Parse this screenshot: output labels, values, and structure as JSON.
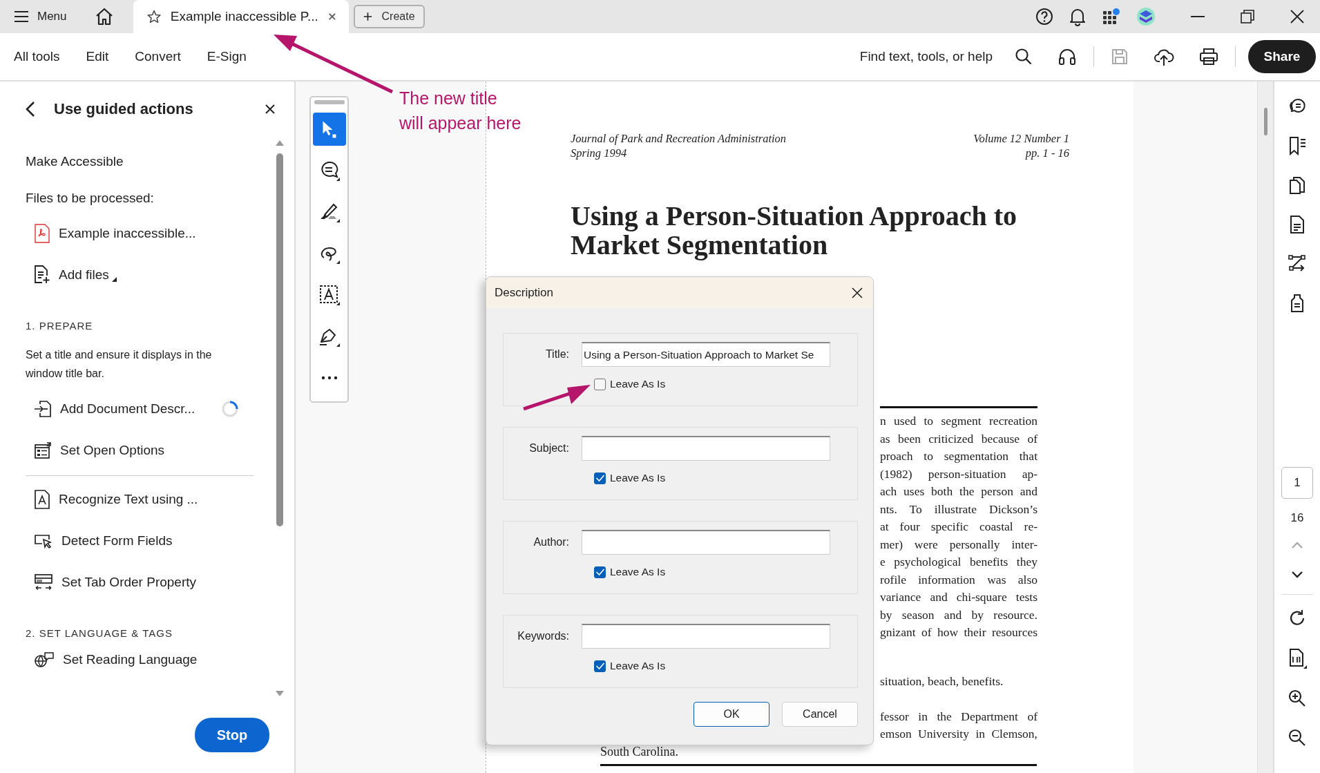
{
  "menu_bar": {
    "menu_label": "Menu",
    "tab": {
      "title": "Example inaccessible P...",
      "selected": true
    },
    "create_button": "Create",
    "apps_notification": true
  },
  "toolbar": {
    "menus": [
      "All tools",
      "Edit",
      "Convert",
      "E-Sign"
    ],
    "search_label": "Find text, tools, or help",
    "save_disabled": true,
    "share_button": "Share"
  },
  "sidebar": {
    "title": "Use guided actions",
    "heading": "Make Accessible",
    "files_label": "Files to be processed:",
    "files": [
      "Example inaccessible..."
    ],
    "add_files": "Add files",
    "sections": [
      {
        "title": "1. PREPARE",
        "description": "Set a title and ensure it displays in the window title bar.",
        "actions": [
          {
            "label": "Add Document Descr...",
            "kind": "describe",
            "in_progress": true,
            "divider_before": false
          },
          {
            "label": "Set Open Options",
            "kind": "open-options",
            "in_progress": false,
            "divider_before": false
          },
          {
            "label": "Recognize Text using ...",
            "kind": "ocr",
            "in_progress": false,
            "divider_before": true
          },
          {
            "label": "Detect Form Fields",
            "kind": "form-fields",
            "in_progress": false,
            "divider_before": false
          },
          {
            "label": "Set Tab Order Property",
            "kind": "tab-order",
            "in_progress": false,
            "divider_before": false
          }
        ]
      },
      {
        "title": "2. SET LANGUAGE & TAGS",
        "actions": [
          {
            "label": "Set Reading Language",
            "kind": "language",
            "in_progress": false,
            "divider_before": false
          }
        ]
      }
    ],
    "stop_button": "Stop"
  },
  "annotation": {
    "text": "The new title\nwill appear here"
  },
  "document": {
    "header_left": [
      "Journal of Park and Recreation Administration",
      "Spring 1994"
    ],
    "header_right": [
      "Volume 12 Number 1",
      "pp. 1 - 16"
    ],
    "title": "Using a Person-Situation Approach to Market Segmentation",
    "abstract_lines": [
      "n used to segment recreation",
      "as been criticized because of",
      "proach to segmentation that",
      "(1982) person-situation ap-",
      "ach uses both the person and",
      "nts. To illustrate Dickson’s",
      "at four specific coastal re-",
      "mer) were personally inter-",
      "e psychological benefits they",
      "rofile information was also",
      "variance and chi-square tests",
      "by season and by resource.",
      "gnizant of how their resources"
    ],
    "keywords_line": "situation, beach, benefits.",
    "footnote_lines": [
      "fessor in the Department of",
      "emson University in Clemson,"
    ],
    "footnote_last": "South Carolina."
  },
  "dialog": {
    "title": "Description",
    "fields": [
      {
        "label": "Title:",
        "value": "Using a Person-Situation Approach to Market Se",
        "leave_as_is_label": "Leave As Is",
        "leave_as_is": false
      },
      {
        "label": "Subject:",
        "leave_as_is_label": "Leave As Is",
        "leave_as_is": true
      },
      {
        "label": "Author:",
        "leave_as_is_label": "Leave As Is",
        "leave_as_is": true
      },
      {
        "label": "Keywords:",
        "leave_as_is_label": "Leave As Is",
        "leave_as_is": true
      }
    ],
    "buttons": [
      {
        "label": "OK",
        "default": true
      },
      {
        "label": "Cancel",
        "default": false
      }
    ]
  },
  "page_nav": {
    "page_number": "1",
    "page_count": "16",
    "previous_disabled": true
  }
}
